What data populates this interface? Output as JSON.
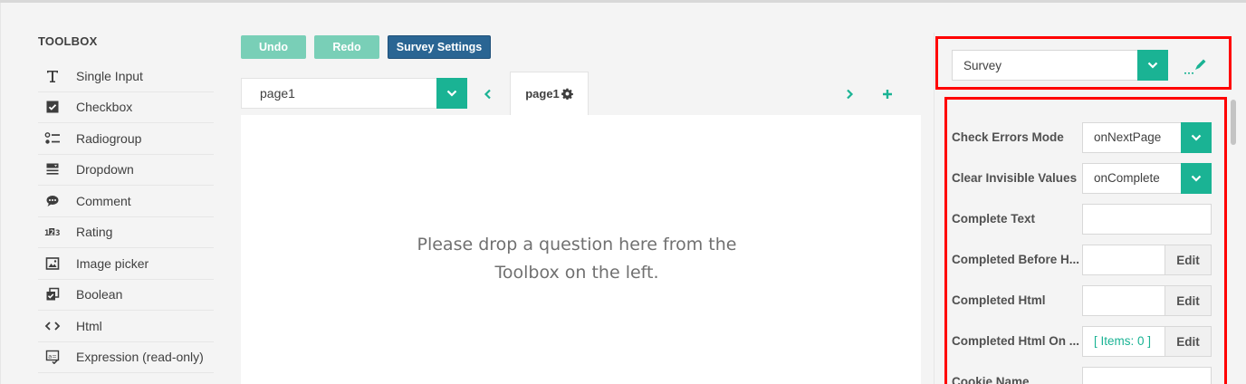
{
  "toolbox": {
    "title": "TOOLBOX",
    "items": [
      {
        "label": "Single Input",
        "icon": "text-input-icon"
      },
      {
        "label": "Checkbox",
        "icon": "checkbox-icon"
      },
      {
        "label": "Radiogroup",
        "icon": "radiogroup-icon"
      },
      {
        "label": "Dropdown",
        "icon": "dropdown-icon"
      },
      {
        "label": "Comment",
        "icon": "comment-icon"
      },
      {
        "label": "Rating",
        "icon": "rating-icon"
      },
      {
        "label": "Image picker",
        "icon": "image-picker-icon"
      },
      {
        "label": "Boolean",
        "icon": "boolean-icon"
      },
      {
        "label": "Html",
        "icon": "html-icon"
      },
      {
        "label": "Expression (read-only)",
        "icon": "expression-icon"
      }
    ]
  },
  "toolbar": {
    "undo_label": "Undo",
    "redo_label": "Redo",
    "settings_label": "Survey Settings"
  },
  "pages": {
    "selected": "page1",
    "tab_label": "page1"
  },
  "designer": {
    "placeholder_line1": "Please drop a question here from the",
    "placeholder_line2": "Toolbox on the left."
  },
  "properties": {
    "object": "Survey",
    "rows": [
      {
        "label": "Check Errors Mode",
        "value": "onNextPage",
        "type": "dropdown"
      },
      {
        "label": "Clear Invisible Values",
        "value": "onComplete",
        "type": "dropdown"
      },
      {
        "label": "Complete Text",
        "value": "",
        "type": "text"
      },
      {
        "label": "Completed Before H...",
        "value": "",
        "type": "edit",
        "button": "Edit"
      },
      {
        "label": "Completed Html",
        "value": "",
        "type": "edit",
        "button": "Edit"
      },
      {
        "label": "Completed Html On ...",
        "value": "[ Items: 0 ]",
        "type": "items",
        "button": "Edit"
      },
      {
        "label": "Cookie Name",
        "value": "",
        "type": "text"
      }
    ]
  },
  "colors": {
    "accent": "#1ab394",
    "button_light": "#79cfb7",
    "button_dark": "#2a6593",
    "highlight": "#ff0000"
  }
}
